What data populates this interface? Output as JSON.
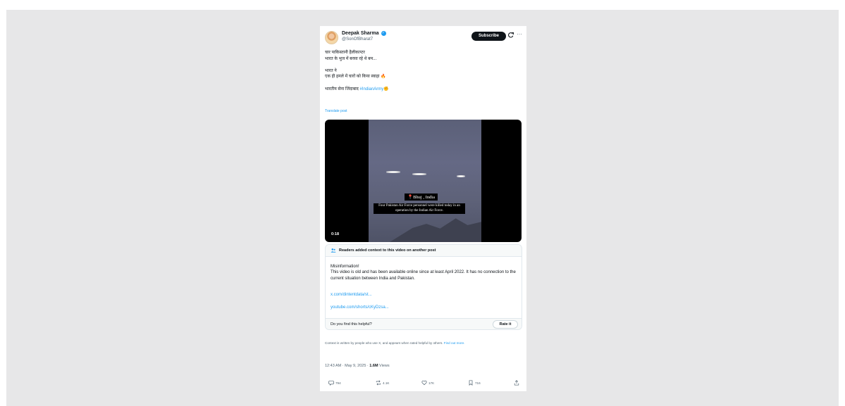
{
  "author": {
    "display_name": "Deepak Sharma",
    "handle": "@SonOfBharat7",
    "verified_glyph": "✓"
  },
  "header": {
    "subscribe_label": "Subscribe",
    "more_glyph": "···"
  },
  "tweet": {
    "line1": "चार पाकिस्तानी हैलीकाप्टर",
    "line2": "भारत के भुज में बरसा रहे थे बम...",
    "line3": "भारत ने",
    "line4": "एक ही हमले में चारों को किया स्वाहा 🔥",
    "line5_prefix": "भारतीय सेना जिंदाबाद ",
    "hashtag": "#IndianArmy",
    "hashtag_emoji": "✊",
    "translate_label": "Translate post"
  },
  "video": {
    "location_pin": "📍",
    "location": "Bhuj , India",
    "caption": "Four Pakistan Air Force personnel were killed today in an operation by the Indian Air Force.",
    "duration": "0:18"
  },
  "community_note": {
    "title": "Readers added context to this video on another post",
    "body_line1": "Misinformation!",
    "body_line2": "This video is old and has been available online since at least April 2022. It has no connection to the current situation between India and Pakistan.",
    "link1": "x.com/dintentdata/st...",
    "link2": "youtube.com/shorts/cKyDzsa...",
    "helpful_question": "Do you find this helpful?",
    "rate_label": "Rate it"
  },
  "context_footer": {
    "text": "Context is written by people who use X, and appears when rated helpful by others. ",
    "link": "Find out more."
  },
  "meta": {
    "timestamp": "12:43 AM · May 9, 2025 · ",
    "views_count": "1.6M",
    "views_label": " Views"
  },
  "actions": {
    "replies": "794",
    "reposts": "4.1K",
    "likes": "17K",
    "bookmarks": "716"
  },
  "colors": {
    "accent": "#1d9bf0",
    "text": "#0f1419",
    "muted": "#536471",
    "backdrop": "#e7e7e8"
  }
}
